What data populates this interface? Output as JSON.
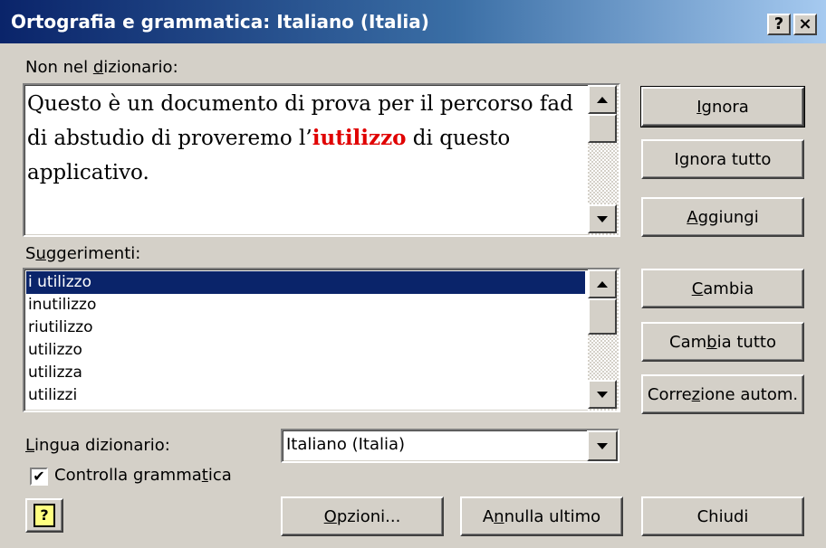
{
  "window": {
    "title": "Ortografia e grammatica: Italiano (Italia)",
    "help_button": "?",
    "close_button": "×"
  },
  "not_in_dictionary": {
    "label_pre": "Non nel ",
    "label_u": "d",
    "label_post": "izionario:",
    "text_before": "Questo è un documento di prova per il percorso fad di abstudio di proveremo l’",
    "error_word": "iutilizzo",
    "text_after": " di questo applicativo."
  },
  "suggestions": {
    "label_pre": "S",
    "label_u": "u",
    "label_post": "ggerimenti:",
    "items": [
      "i utilizzo",
      "inutilizzo",
      "riutilizzo",
      "utilizzo",
      "utilizza",
      "utilizzi"
    ],
    "selected_index": 0
  },
  "language": {
    "label_u": "L",
    "label_post": "ingua dizionario:",
    "value": "Italiano (Italia)"
  },
  "grammar_check": {
    "label_pre": "Controlla gramma",
    "label_u": "t",
    "label_post": "ica",
    "checked": true,
    "mark": "✔"
  },
  "buttons": {
    "ignore": {
      "pre": "",
      "u": "I",
      "post": "gnora"
    },
    "ignore_all": {
      "pre": "I",
      "u": "g",
      "post": "nora tutto"
    },
    "add": {
      "pre": "",
      "u": "A",
      "post": "ggiungi"
    },
    "change": {
      "pre": "",
      "u": "C",
      "post": "ambia"
    },
    "change_all": {
      "pre": "Cam",
      "u": "b",
      "post": "ia tutto"
    },
    "autocorrect": {
      "pre": "Corre",
      "u": "z",
      "post": "ione autom."
    },
    "options": {
      "pre": "",
      "u": "O",
      "post": "pzioni..."
    },
    "undo": {
      "pre": "A",
      "u": "n",
      "post": "nulla ultimo"
    },
    "close": {
      "pre": "",
      "u": "",
      "post": "Chiudi"
    }
  },
  "office_assistant": {
    "glyph": "?"
  }
}
